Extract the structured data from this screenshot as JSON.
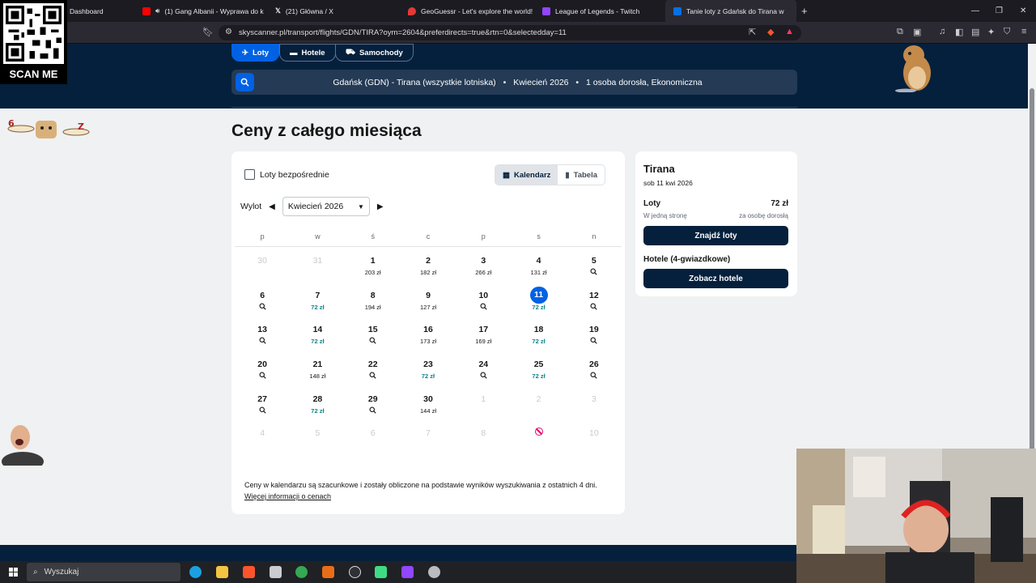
{
  "browser": {
    "tabs": [
      {
        "label": "Dashboard",
        "fav": "#1e88e5"
      },
      {
        "label": "(1) Gang Albanii - Wyprawa do k",
        "fav": "#ff0000"
      },
      {
        "label": "(21) Główna / X",
        "fav": "#000000"
      },
      {
        "label": "GeoGuessr - Let's explore the world!",
        "fav": "#e53935"
      },
      {
        "label": "League of Legends - Twitch",
        "fav": "#9146ff"
      },
      {
        "label": "Tanie loty z Gdańsk do Tirana w",
        "fav": "#0770e3"
      }
    ],
    "url": "skyscanner.pl/transport/flights/GDN/TIRA?oym=2604&preferdirects=true&rtn=0&selectedday=11"
  },
  "header": {
    "nav": [
      "Loty",
      "Hotele",
      "Samochody"
    ],
    "search_route": "Gdańsk (GDN) - Tirana (wszystkie lotniska)",
    "search_month": "Kwiecień 2026",
    "search_pax": "1 osoba dorosła, Ekonomiczna"
  },
  "main": {
    "title": "Ceny z całego miesiąca",
    "direct_label": "Loty bezpośrednie",
    "view_calendar": "Kalendarz",
    "view_table": "Tabela",
    "depart_label": "Wylot",
    "month": "Kwiecień 2026",
    "weekdays": [
      "p",
      "w",
      "ś",
      "c",
      "p",
      "s",
      "n"
    ],
    "days": [
      {
        "d": "30",
        "out": true
      },
      {
        "d": "31",
        "out": true
      },
      {
        "d": "1",
        "p": "203 zł"
      },
      {
        "d": "2",
        "p": "182 zł"
      },
      {
        "d": "3",
        "p": "266 zł"
      },
      {
        "d": "4",
        "p": "131 zł"
      },
      {
        "d": "5",
        "mag": true
      },
      {
        "d": "6",
        "mag": true
      },
      {
        "d": "7",
        "p": "72 zł",
        "low": true
      },
      {
        "d": "8",
        "p": "194 zł"
      },
      {
        "d": "9",
        "p": "127 zł"
      },
      {
        "d": "10",
        "mag": true
      },
      {
        "d": "11",
        "p": "72 zł",
        "low": true,
        "sel": true
      },
      {
        "d": "12",
        "mag": true
      },
      {
        "d": "13",
        "mag": true
      },
      {
        "d": "14",
        "p": "72 zł",
        "low": true
      },
      {
        "d": "15",
        "mag": true
      },
      {
        "d": "16",
        "p": "173 zł"
      },
      {
        "d": "17",
        "p": "169 zł"
      },
      {
        "d": "18",
        "p": "72 zł",
        "low": true
      },
      {
        "d": "19",
        "mag": true
      },
      {
        "d": "20",
        "mag": true
      },
      {
        "d": "21",
        "p": "148 zł"
      },
      {
        "d": "22",
        "mag": true
      },
      {
        "d": "23",
        "p": "72 zł",
        "low": true
      },
      {
        "d": "24",
        "mag": true
      },
      {
        "d": "25",
        "p": "72 zł",
        "low": true
      },
      {
        "d": "26",
        "mag": true
      },
      {
        "d": "27",
        "mag": true
      },
      {
        "d": "28",
        "p": "72 zł",
        "low": true
      },
      {
        "d": "29",
        "mag": true
      },
      {
        "d": "30",
        "p": "144 zł"
      },
      {
        "d": "1",
        "out": true
      },
      {
        "d": "2",
        "out": true
      },
      {
        "d": "3",
        "out": true
      },
      {
        "d": "4",
        "out": true
      },
      {
        "d": "5",
        "out": true
      },
      {
        "d": "6",
        "out": true
      },
      {
        "d": "7",
        "out": true
      },
      {
        "d": "8",
        "out": true
      },
      {
        "d": "9",
        "out": true,
        "noflight": true
      },
      {
        "d": "10",
        "out": true
      }
    ],
    "disclaimer": "Ceny w kalendarzu są szacunkowe i zostały obliczone na podstawie wyników wyszukiwania z ostatnich 4 dni.",
    "more_link": "Więcej informacji o cenach"
  },
  "side": {
    "destination": "Tirana",
    "date": "sob 11 kwi 2026",
    "flights_label": "Loty",
    "flights_price": "72 zł",
    "one_way": "W jedną stronę",
    "per_adult": "za osobę dorosłą",
    "find_button": "Znajdź loty",
    "hotels_label": "Hotele (4-gwiazdkowe)",
    "hotels_button": "Zobacz hotele"
  },
  "taskbar": {
    "search_placeholder": "Wyszukaj"
  },
  "overlay": {
    "scan_label": "SCAN ME"
  },
  "colors": {
    "brand_dark": "#05203c",
    "accent": "#0062e3",
    "low_price": "#0c838a"
  }
}
